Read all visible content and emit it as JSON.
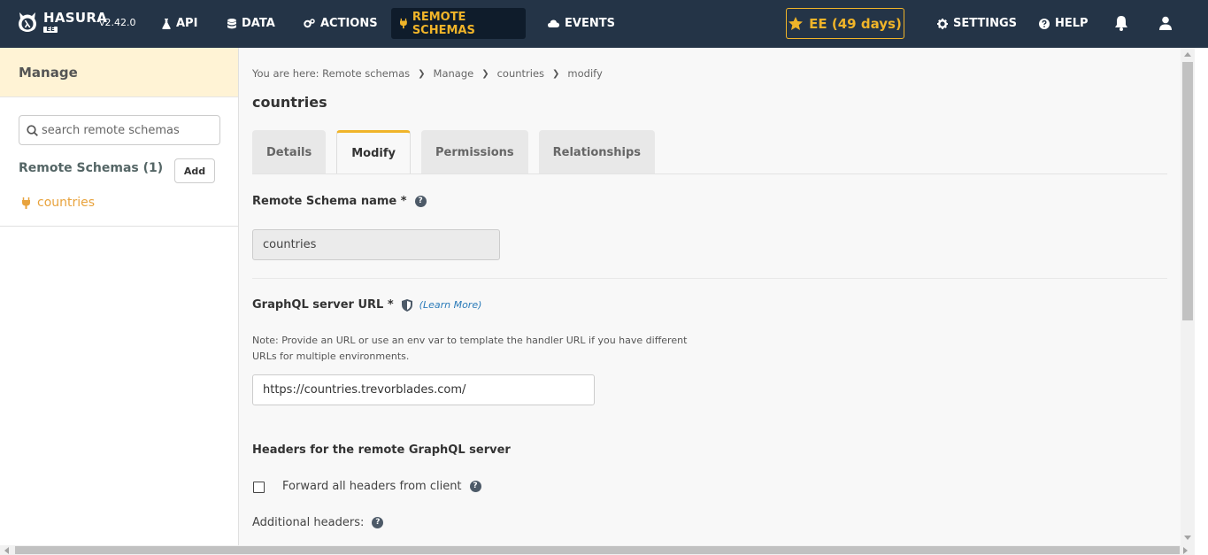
{
  "topnav": {
    "logo_text": "HASURA",
    "logo_badge": "EE",
    "version": "v2.42.0",
    "items": [
      {
        "label": "API",
        "icon": "flask-icon"
      },
      {
        "label": "DATA",
        "icon": "database-icon"
      },
      {
        "label": "ACTIONS",
        "icon": "cogs-icon"
      },
      {
        "label": "REMOTE SCHEMAS",
        "icon": "plug-icon",
        "active": true
      },
      {
        "label": "EVENTS",
        "icon": "cloud-icon"
      }
    ],
    "ee_button": "EE (49 days)",
    "settings": "SETTINGS",
    "help": "HELP",
    "colors": {
      "bg": "#243447",
      "accent": "#f0b429"
    }
  },
  "sidebar": {
    "header": "Manage",
    "search_placeholder": "search remote schemas",
    "remote_schemas_title": "Remote Schemas (1)",
    "add_label": "Add",
    "items": [
      {
        "label": "countries"
      }
    ]
  },
  "main": {
    "breadcrumb": [
      "You are here: Remote schemas",
      "Manage",
      "countries",
      "modify"
    ],
    "title": "countries",
    "tabs": [
      {
        "label": "Details"
      },
      {
        "label": "Modify",
        "active": true
      },
      {
        "label": "Permissions"
      },
      {
        "label": "Relationships"
      }
    ],
    "form": {
      "name_label": "Remote Schema name *",
      "name_value": "countries",
      "url_label": "GraphQL server URL *",
      "learn_more": "(Learn More)",
      "url_note": "Note: Provide an URL or use an env var to template the handler URL if you have different URLs for multiple environments.",
      "url_value": "https://countries.trevorblades.com/",
      "headers_title": "Headers for the remote GraphQL server",
      "forward_label": "Forward all headers from client",
      "forward_checked": false,
      "additional_headers_label": "Additional headers:"
    }
  }
}
